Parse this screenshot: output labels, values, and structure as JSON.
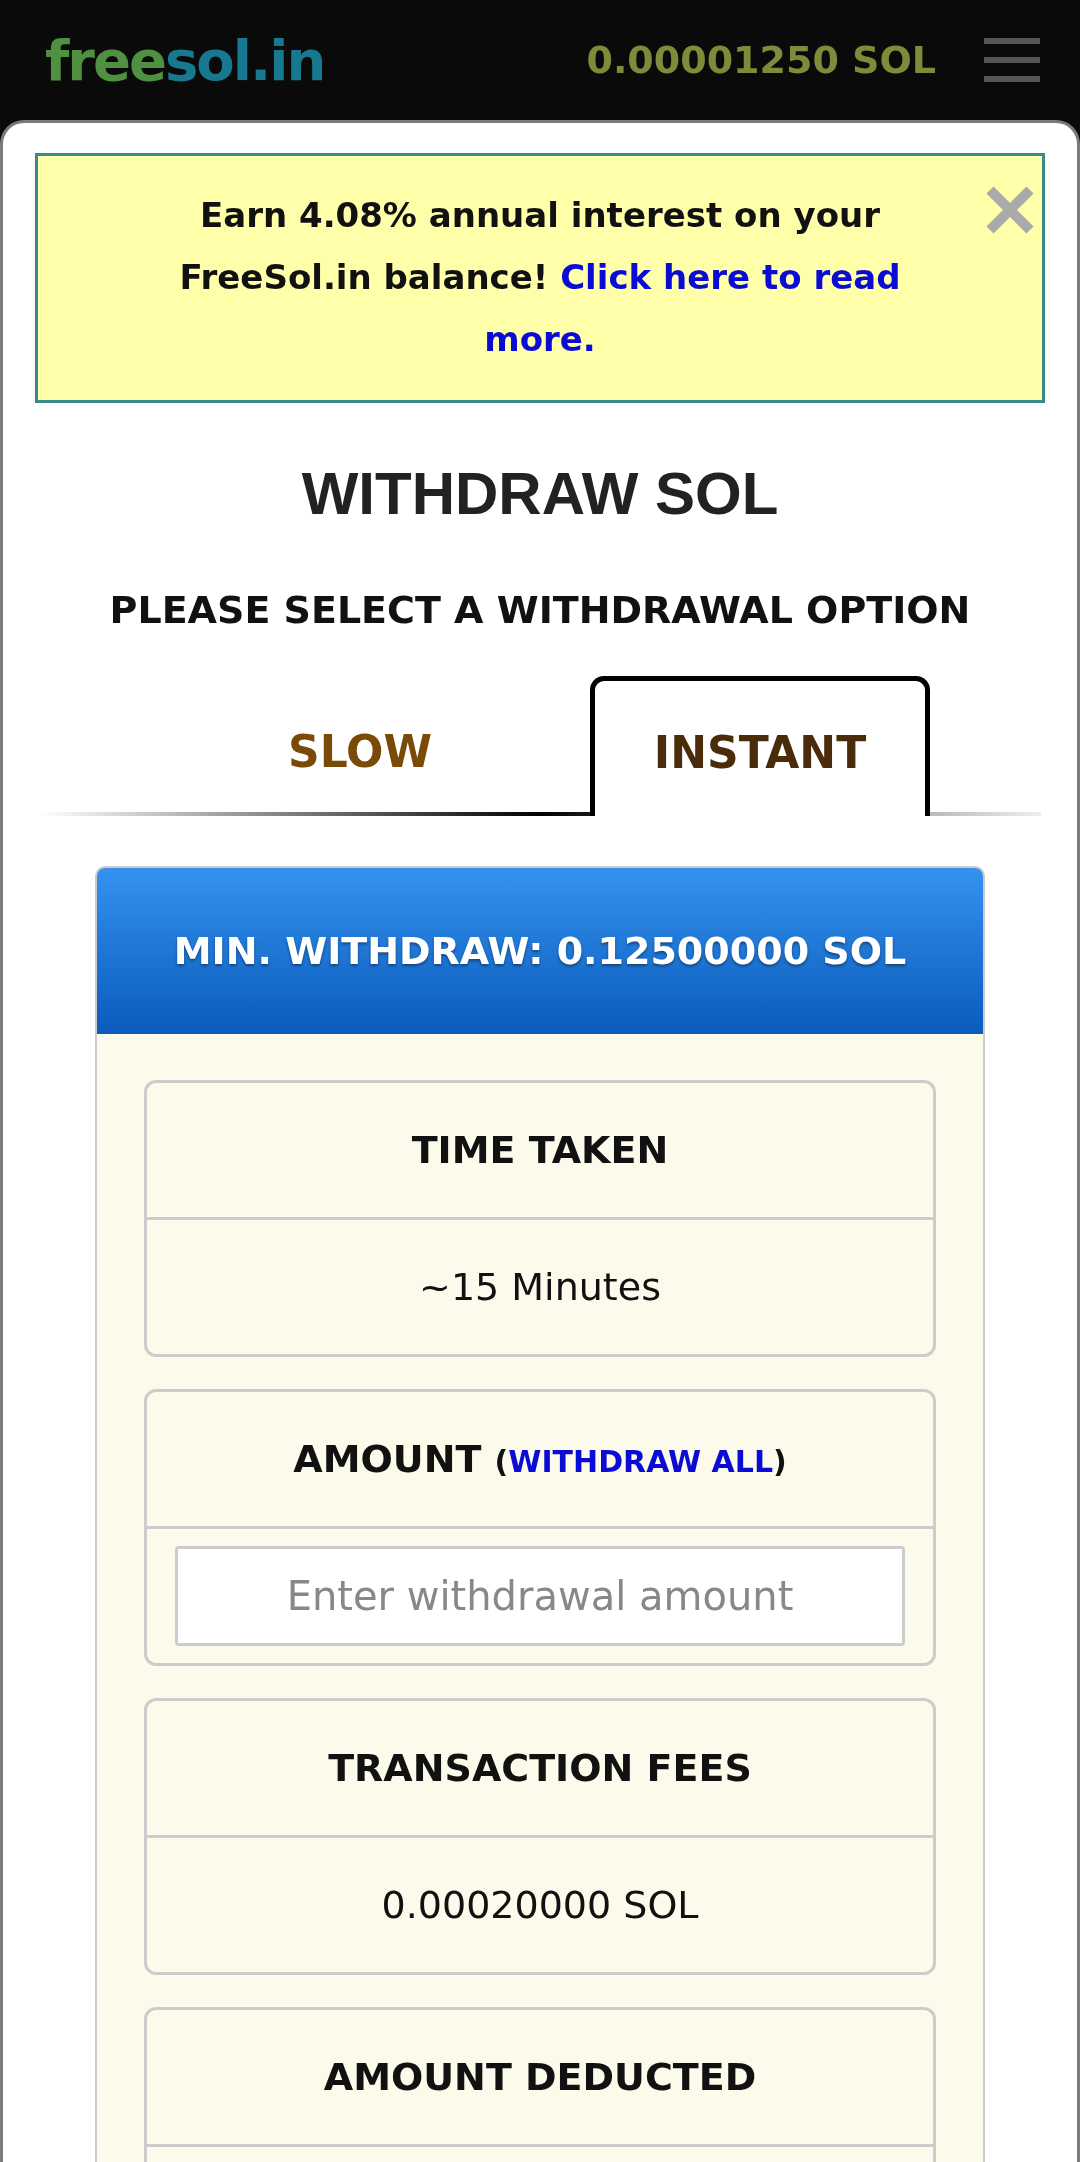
{
  "header": {
    "logo": {
      "part_1": "free",
      "part_2": "sol.in"
    },
    "balance": "0.00001250 SOL"
  },
  "banner": {
    "text": "Earn 4.08% annual interest on your FreeSol.in balance!",
    "link_lines": [
      "Click here to read",
      "more."
    ]
  },
  "title": "WITHDRAW SOL",
  "subtitle": "PLEASE SELECT A WITHDRAWAL OPTION",
  "tabs": [
    {
      "label": "SLOW",
      "selected": false
    },
    {
      "label": "INSTANT",
      "selected": true
    }
  ],
  "min_withdraw": "MIN. WITHDRAW: 0.12500000 SOL",
  "fields": [
    {
      "kind": "text",
      "title": "TIME TAKEN",
      "value": "~15 Minutes"
    },
    {
      "kind": "input",
      "title": "AMOUNT",
      "link": {
        "before": "(",
        "text": "WITHDRAW ALL",
        "after": ")"
      },
      "placeholder": "Enter withdrawal amount"
    },
    {
      "kind": "text",
      "title": "TRANSACTION FEES",
      "value": "0.00020000 SOL"
    },
    {
      "kind": "text",
      "title": "AMOUNT DEDUCTED"
    }
  ]
}
